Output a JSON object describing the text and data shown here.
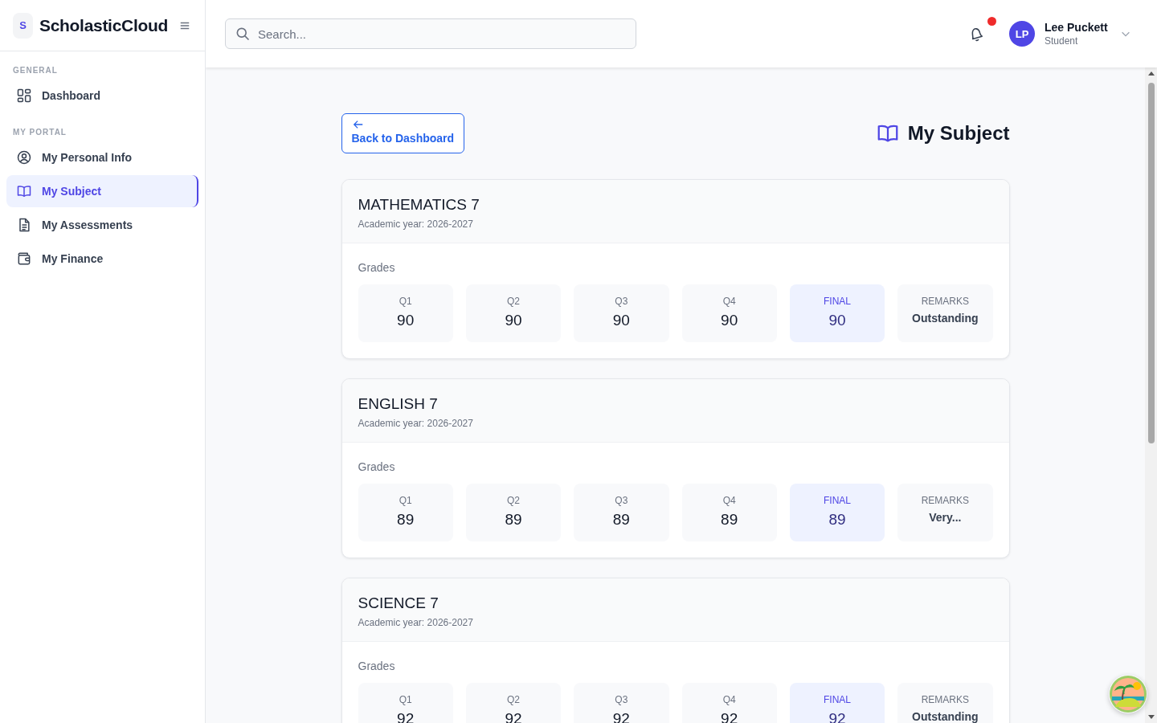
{
  "brand": {
    "logo_letter": "S",
    "name": "ScholasticCloud"
  },
  "sidebar": {
    "sections": [
      {
        "heading": "GENERAL",
        "items": [
          {
            "label": "Dashboard",
            "kind": "grid",
            "selected": false
          }
        ]
      },
      {
        "heading": "MY PORTAL",
        "items": [
          {
            "label": "My Personal Info",
            "kind": "user",
            "selected": false
          },
          {
            "label": "My Subject",
            "kind": "book",
            "selected": true
          },
          {
            "label": "My Assessments",
            "kind": "document",
            "selected": false
          },
          {
            "label": "My Finance",
            "kind": "wallet",
            "selected": false
          }
        ]
      }
    ]
  },
  "search": {
    "placeholder": "Search..."
  },
  "notifications": {
    "has_unread": true
  },
  "user": {
    "initials": "LP",
    "name": "Lee Puckett",
    "role": "Student"
  },
  "page": {
    "back_button": "Back to Dashboard",
    "title": "My Subject"
  },
  "subjects": [
    {
      "name": "MATHEMATICS 7",
      "year": "Academic year: 2026-2027",
      "grades_label": "Grades",
      "grades": [
        {
          "label": "Q1",
          "value": "90",
          "kind": "quarter"
        },
        {
          "label": "Q2",
          "value": "90",
          "kind": "quarter"
        },
        {
          "label": "Q3",
          "value": "90",
          "kind": "quarter"
        },
        {
          "label": "Q4",
          "value": "90",
          "kind": "quarter"
        },
        {
          "label": "FINAL",
          "value": "90",
          "kind": "final"
        },
        {
          "label": "REMARKS",
          "value": "Outstanding",
          "kind": "remarks"
        }
      ]
    },
    {
      "name": "ENGLISH 7",
      "year": "Academic year: 2026-2027",
      "grades_label": "Grades",
      "grades": [
        {
          "label": "Q1",
          "value": "89",
          "kind": "quarter"
        },
        {
          "label": "Q2",
          "value": "89",
          "kind": "quarter"
        },
        {
          "label": "Q3",
          "value": "89",
          "kind": "quarter"
        },
        {
          "label": "Q4",
          "value": "89",
          "kind": "quarter"
        },
        {
          "label": "FINAL",
          "value": "89",
          "kind": "final"
        },
        {
          "label": "REMARKS",
          "value": "Very...",
          "kind": "remarks"
        }
      ]
    },
    {
      "name": "SCIENCE 7",
      "year": "Academic year: 2026-2027",
      "grades_label": "Grades",
      "grades": [
        {
          "label": "Q1",
          "value": "92",
          "kind": "quarter"
        },
        {
          "label": "Q2",
          "value": "92",
          "kind": "quarter"
        },
        {
          "label": "Q3",
          "value": "92",
          "kind": "quarter"
        },
        {
          "label": "Q4",
          "value": "92",
          "kind": "quarter"
        },
        {
          "label": "FINAL",
          "value": "92",
          "kind": "final"
        },
        {
          "label": "REMARKS",
          "value": "Outstanding",
          "kind": "remarks"
        }
      ]
    }
  ]
}
